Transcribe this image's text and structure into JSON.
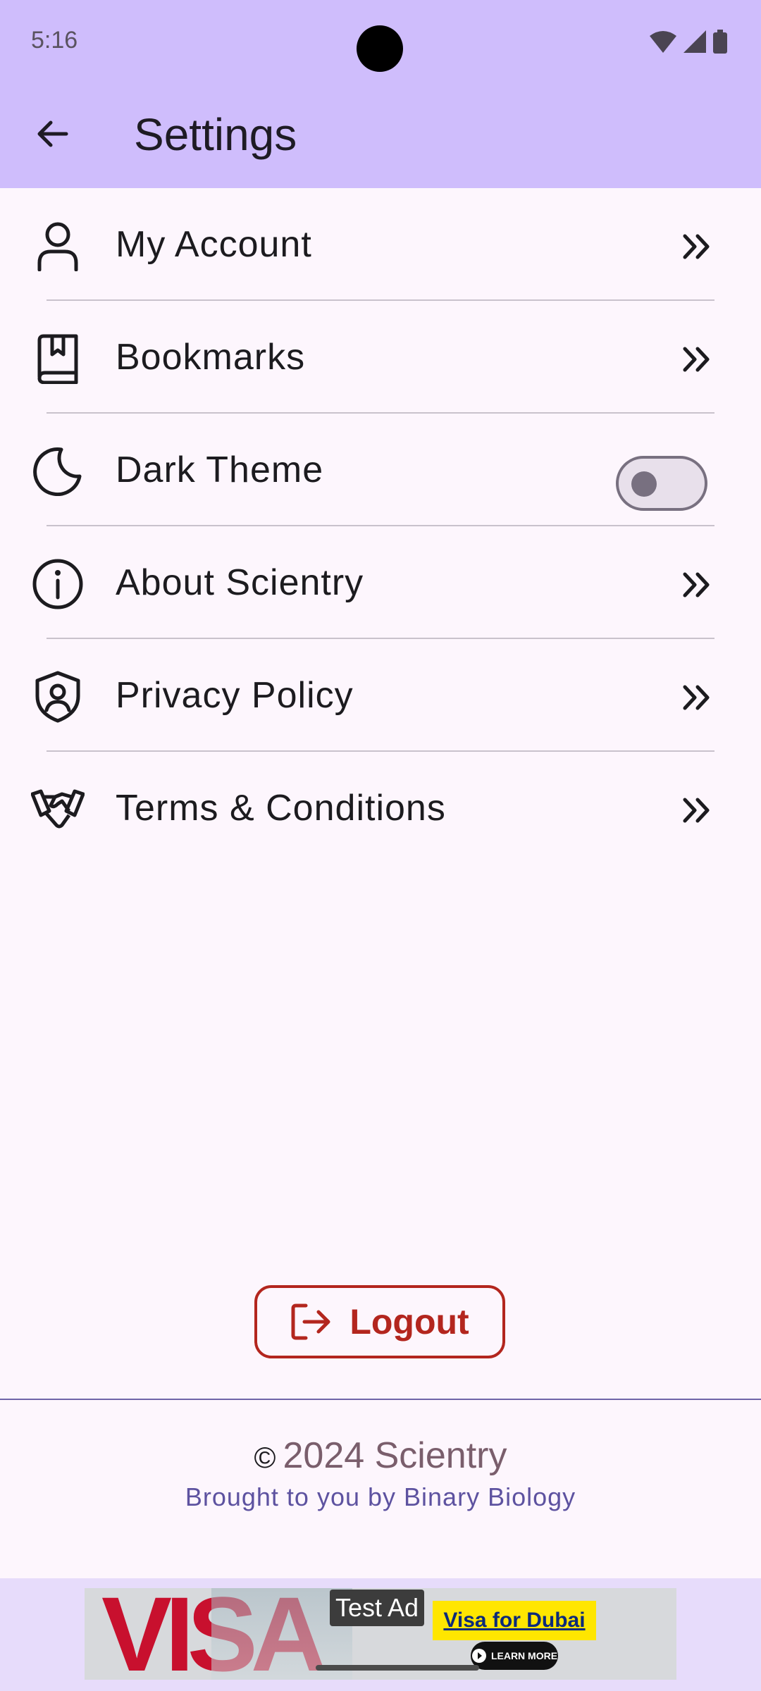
{
  "status_bar": {
    "time": "5:16"
  },
  "app_bar": {
    "title": "Settings"
  },
  "settings": [
    {
      "label": "My Account",
      "icon": "person-icon",
      "trailing": "chevron-double-right-icon"
    },
    {
      "label": "Bookmarks",
      "icon": "bookmark-book-icon",
      "trailing": "chevron-double-right-icon"
    },
    {
      "label": "Dark Theme",
      "icon": "moon-icon",
      "trailing": "toggle",
      "toggle_on": false
    },
    {
      "label": "About Scientry",
      "icon": "info-icon",
      "trailing": "chevron-double-right-icon"
    },
    {
      "label": "Privacy Policy",
      "icon": "shield-user-icon",
      "trailing": "chevron-double-right-icon"
    },
    {
      "label": "Terms & Conditions",
      "icon": "handshake-icon",
      "trailing": "chevron-double-right-icon"
    }
  ],
  "logout": {
    "label": "Logout"
  },
  "footer": {
    "copyright_symbol": "©",
    "copyright": "2024 Scientry",
    "credit": "Brought to you by Binary Biology"
  },
  "ad": {
    "tag": "Test Ad",
    "brand": "VISA",
    "offer": "Visa for Dubai",
    "cta": "LEARN MORE"
  },
  "colors": {
    "app_bar": "#cfbdfc",
    "background": "#fdf6fd",
    "logout": "#b3261e",
    "credit": "#5d52a0"
  }
}
